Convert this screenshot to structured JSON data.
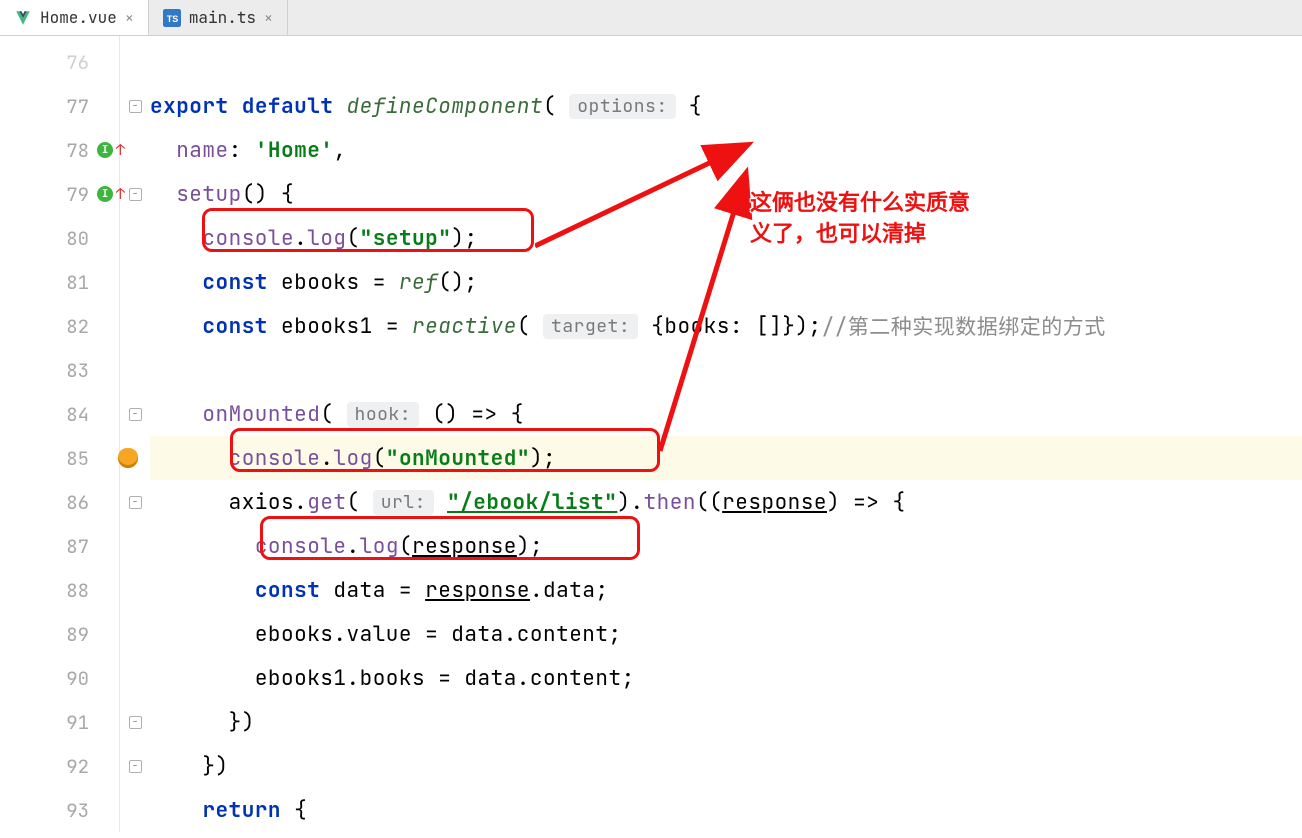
{
  "tabs": [
    {
      "label": "Home.vue",
      "icon": "vue"
    },
    {
      "label": "main.ts",
      "icon": "ts"
    }
  ],
  "gutter": {
    "start": 76,
    "lines": [
      "76",
      "77",
      "78",
      "79",
      "80",
      "81",
      "82",
      "83",
      "84",
      "85",
      "86",
      "87",
      "88",
      "89",
      "90",
      "91",
      "92",
      "93"
    ]
  },
  "code": {
    "l77_export": "export",
    "l77_default": "default",
    "l77_fn": "defineComponent",
    "l77_hint": "options:",
    "l78_name": "name",
    "l78_val": "'Home'",
    "l79_setup": "setup",
    "l80_console": "console",
    "l80_log": "log",
    "l80_str": "\"setup\"",
    "l81_const": "const",
    "l81_id": "ebooks",
    "l81_fn": "ref",
    "l82_const": "const",
    "l82_id": "ebooks1",
    "l82_fn": "reactive",
    "l82_hint": "target:",
    "l82_body": "{books: []});",
    "l82_cmt": "//第二种实现数据绑定的方式",
    "l84_fn": "onMounted",
    "l84_hint": "hook:",
    "l85_console": "console",
    "l85_log": "log",
    "l85_str": "\"onMounted\"",
    "l86_axios": "axios",
    "l86_get": "get",
    "l86_hint": "url:",
    "l86_url": "\"/ebook/list\"",
    "l86_then": "then",
    "l86_resp": "response",
    "l87_console": "console",
    "l87_log": "log",
    "l87_resp": "response",
    "l88_const": "const",
    "l88_data": "data",
    "l88_resp": "response",
    "l89_line": "ebooks.value = data.content;",
    "l90_line": "ebooks1.books = data.content;",
    "l91_line": "})",
    "l92_line": "})",
    "l93_return": "return",
    "l93_brace": "{"
  },
  "annotation": {
    "text_line1": "这俩也没有什么实质意",
    "text_line2": "义了，也可以清掉"
  }
}
